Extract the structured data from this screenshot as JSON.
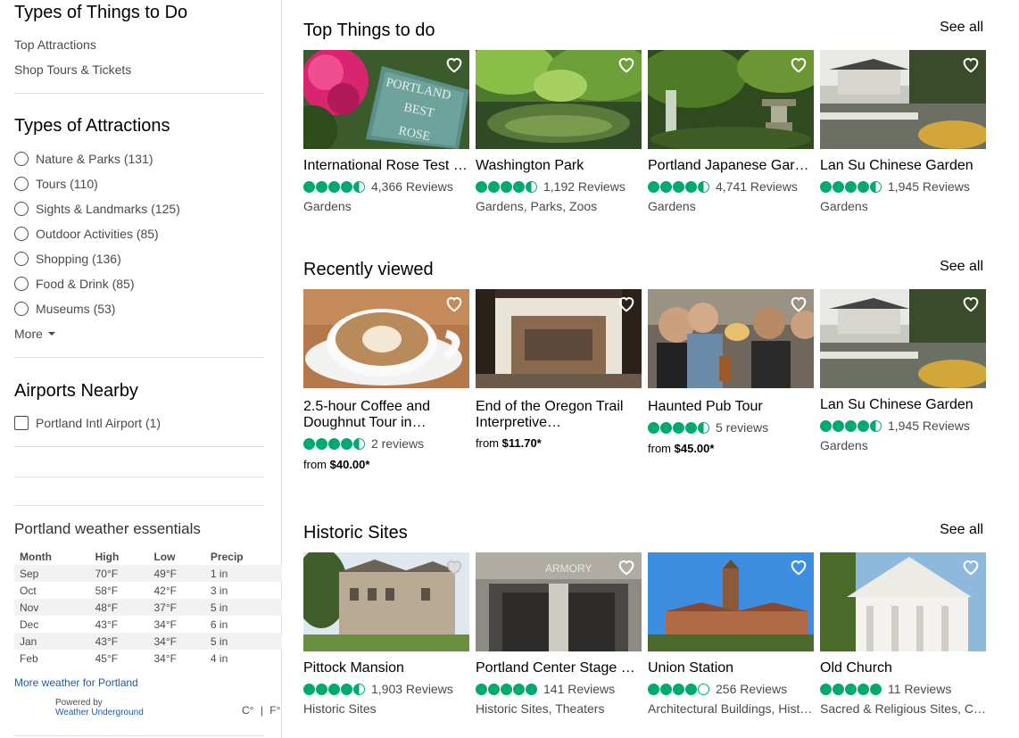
{
  "sidebar": {
    "things_heading": "Types of Things to Do",
    "things_links": [
      "Top Attractions",
      "Shop Tours & Tickets"
    ],
    "attractions_heading": "Types of Attractions",
    "attractions": [
      "Nature & Parks (131)",
      "Tours (110)",
      "Sights & Landmarks (125)",
      "Outdoor Activities (85)",
      "Shopping (136)",
      "Food & Drink (85)",
      "Museums (53)"
    ],
    "more_label": "More",
    "airports_heading": "Airports Nearby",
    "airports": [
      "Portland Intl Airport (1)"
    ],
    "weather": {
      "heading": "Portland weather essentials",
      "columns": [
        "Month",
        "High",
        "Low",
        "Precip"
      ],
      "rows": [
        [
          "Sep",
          "70°F",
          "49°F",
          "1 in"
        ],
        [
          "Oct",
          "58°F",
          "42°F",
          "3 in"
        ],
        [
          "Nov",
          "48°F",
          "37°F",
          "5 in"
        ],
        [
          "Dec",
          "43°F",
          "34°F",
          "6 in"
        ],
        [
          "Jan",
          "43°F",
          "34°F",
          "5 in"
        ],
        [
          "Feb",
          "45°F",
          "34°F",
          "4 in"
        ]
      ],
      "more_link": "More weather for Portland",
      "powered_by": "Powered by",
      "provider": "Weather Underground",
      "unit_c": "C°",
      "unit_sep": "|",
      "unit_f": "F°"
    }
  },
  "sections": [
    {
      "title": "Top Things to do",
      "see_all": "See all",
      "cards": [
        {
          "title": "International Rose Test Garden",
          "rating": 4.5,
          "reviews": "4,366 Reviews",
          "category": "Gardens"
        },
        {
          "title": "Washington Park",
          "rating": 4.5,
          "reviews": "1,192 Reviews",
          "category": "Gardens, Parks, Zoos"
        },
        {
          "title": "Portland Japanese Garden",
          "rating": 4.5,
          "reviews": "4,741 Reviews",
          "category": "Gardens"
        },
        {
          "title": "Lan Su Chinese Garden",
          "rating": 4.5,
          "reviews": "1,945 Reviews",
          "category": "Gardens"
        }
      ]
    },
    {
      "title": "Recently viewed",
      "see_all": "See all",
      "cards": [
        {
          "title": "2.5-hour Coffee and Doughnut Tour in…",
          "rating": 4.5,
          "reviews": "2 reviews",
          "price_prefix": "from ",
          "price": "$40.00*"
        },
        {
          "title": "End of the Oregon Trail Interpretive…",
          "price_prefix": "from ",
          "price": "$11.70*"
        },
        {
          "title": "Haunted Pub Tour",
          "rating": 4.5,
          "reviews": "5 reviews",
          "price_prefix": "from ",
          "price": "$45.00*"
        },
        {
          "title": "Lan Su Chinese Garden",
          "rating": 4.5,
          "reviews": "1,945 Reviews",
          "category": "Gardens"
        }
      ]
    },
    {
      "title": "Historic Sites",
      "see_all": "See all",
      "cards": [
        {
          "title": "Pittock Mansion",
          "rating": 4.5,
          "reviews": "1,903 Reviews",
          "category": "Historic Sites"
        },
        {
          "title": "Portland Center Stage at The Armory",
          "rating": 5,
          "reviews": "141 Reviews",
          "category": "Historic Sites, Theaters"
        },
        {
          "title": "Union Station",
          "rating": 4,
          "reviews": "256 Reviews",
          "category": "Architectural Buildings, Historic Sites"
        },
        {
          "title": "Old Church",
          "rating": 5,
          "reviews": "11 Reviews",
          "category": "Sacred & Religious Sites, Concerts"
        }
      ]
    }
  ],
  "photo_text": {
    "rose_sign": [
      "PORTLAND",
      "BEST",
      "ROSE"
    ],
    "armory_sign": "ARMORY"
  },
  "colors": {
    "bubble_green": "#00aa6c",
    "link_blue": "#1a5ca8"
  }
}
